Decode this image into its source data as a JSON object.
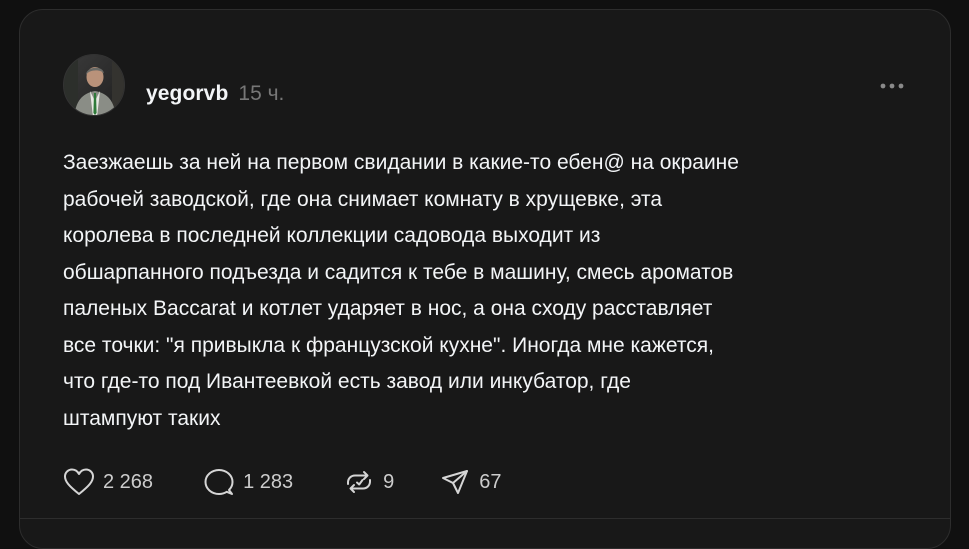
{
  "post": {
    "username": "yegorvb",
    "time": "15 ч.",
    "text": "Заезжаешь за ней на первом свидании в какие-то ебен@ на окраине\nрабочей заводской, где она снимает комнату в хрущевке, эта\nкоролева в последней коллекции садовода выходит из\nобшарпанного подъезда и садится к тебе в машину, смесь ароматов\nпаленых Baccarat и котлет ударяет в нос, а она сходу расставляет\nвсе точки: \"я привыкла к французской кухне\". Иногда мне кажется,\nчто где-то под Ивантеевкой есть завод или инкубатор, где\nштампуют таких",
    "likes": "2 268",
    "replies": "1 283",
    "reposts": "9",
    "shares": "67"
  },
  "icons": {
    "more": "more-horizontal-icon",
    "like": "heart-icon",
    "reply": "comment-bubble-icon",
    "repost": "repost-icon",
    "share": "send-icon"
  },
  "colors": {
    "background": "#101010",
    "card": "#181818",
    "text": "#f3f5f7",
    "muted": "#777777"
  }
}
